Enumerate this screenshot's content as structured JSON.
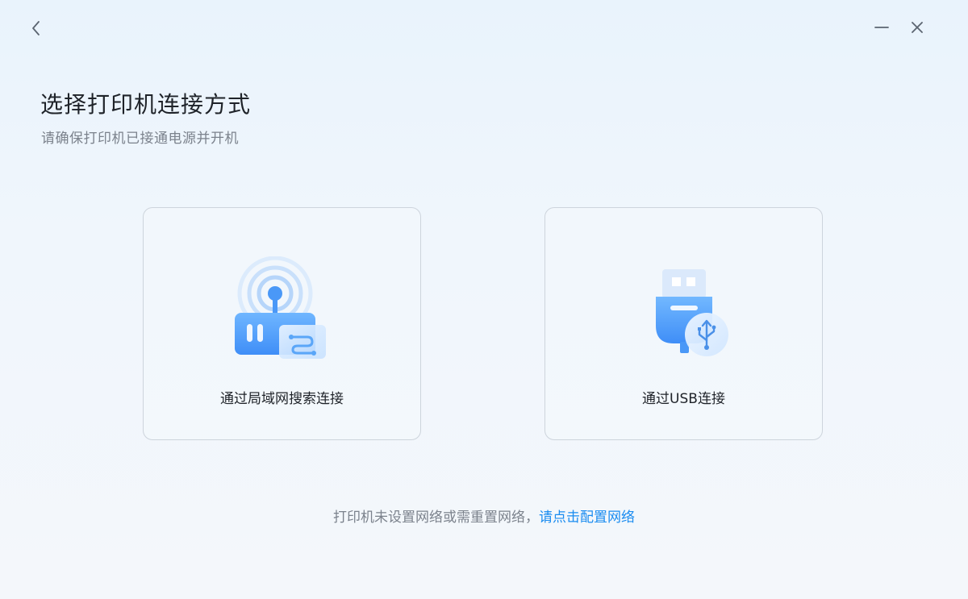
{
  "header": {
    "title": "选择打印机连接方式",
    "subtitle": "请确保打印机已接通电源并开机"
  },
  "options": [
    {
      "label": "通过局域网搜索连接",
      "icon": "router-wifi-icon"
    },
    {
      "label": "通过USB连接",
      "icon": "usb-icon"
    }
  ],
  "footer": {
    "text": "打印机未设置网络或需重置网络，",
    "link": "请点击配置网络"
  },
  "colors": {
    "accent": "#1a8cf0",
    "title": "#1f2329",
    "muted": "#7b828c",
    "card_border": "#cdd4dc"
  }
}
